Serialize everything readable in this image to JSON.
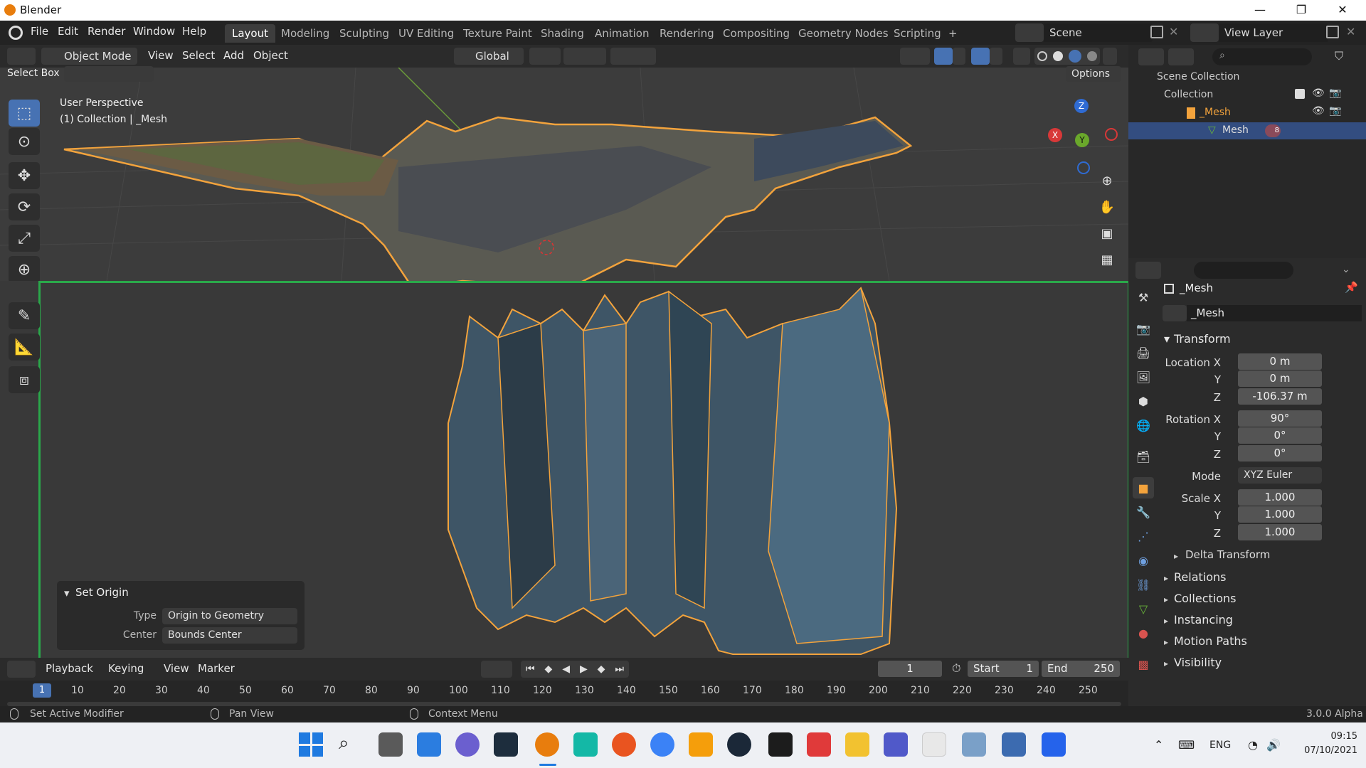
{
  "window": {
    "title": "Blender",
    "controls": [
      "—",
      "❐",
      "✕"
    ]
  },
  "menubar": {
    "items": [
      "File",
      "Edit",
      "Render",
      "Window",
      "Help"
    ]
  },
  "workspaces": {
    "tabs": [
      "Layout",
      "Modeling",
      "Sculpting",
      "UV Editing",
      "Texture Paint",
      "Shading",
      "Animation",
      "Rendering",
      "Compositing",
      "Geometry Nodes",
      "Scripting"
    ],
    "active": "Layout",
    "add_label": "+"
  },
  "scene": {
    "label": "Scene",
    "view_layer": "View Layer"
  },
  "viewport_header": {
    "mode": "Object Mode",
    "menus": [
      "View",
      "Select",
      "Add",
      "Object"
    ],
    "transform_orientation": "Global",
    "select_box_label": "Select Box",
    "options_label": "Options"
  },
  "viewport_overlay": {
    "perspective": "User Perspective",
    "collection_info": "(1) Collection | _Mesh"
  },
  "navigation_gizmo": {
    "z": "Z",
    "y": "Y",
    "x": "X"
  },
  "set_origin_panel": {
    "title": "Set Origin",
    "type_label": "Type",
    "type_value": "Origin to Geometry",
    "center_label": "Center",
    "center_value": "Bounds Center"
  },
  "outliner": {
    "items": [
      {
        "label": "Scene Collection"
      },
      {
        "label": "Collection"
      },
      {
        "label": "_Mesh"
      },
      {
        "label": "Mesh"
      }
    ],
    "badge": "8"
  },
  "properties": {
    "object_name": "_Mesh",
    "datablock_name": "_Mesh",
    "transform_title": "Transform",
    "location": {
      "label": "Location X",
      "x": "0 m",
      "y": "0 m",
      "z": "-106.37 m"
    },
    "rotation": {
      "label": "Rotation X",
      "x": "90°",
      "y": "0°",
      "z": "0°"
    },
    "mode_label": "Mode",
    "mode_value": "XYZ Euler",
    "scale": {
      "label": "Scale X",
      "x": "1.000",
      "y": "1.000",
      "z": "1.000"
    },
    "axis_y": "Y",
    "axis_z": "Z",
    "sections": [
      "Delta Transform",
      "Relations",
      "Collections",
      "Instancing",
      "Motion Paths",
      "Visibility"
    ]
  },
  "timeline": {
    "menus": [
      "Playback",
      "Keying",
      "View",
      "Marker"
    ],
    "current_frame": "1",
    "start_label": "Start",
    "start": "1",
    "end_label": "End",
    "end": "250",
    "ticks": [
      "10",
      "20",
      "30",
      "40",
      "50",
      "60",
      "70",
      "80",
      "90",
      "100",
      "110",
      "120",
      "130",
      "140",
      "150",
      "160",
      "170",
      "180",
      "190",
      "200",
      "210",
      "220",
      "230",
      "240",
      "250"
    ],
    "frame_marker": "1"
  },
  "statusbar": {
    "hint1": "Set Active Modifier",
    "hint2": "Pan View",
    "hint3": "Context Menu",
    "version": "3.0.0 Alpha"
  },
  "taskbar": {
    "lang": "ENG",
    "time": "09:15",
    "date": "07/10/2021"
  },
  "colors": {
    "accent_blue": "#4772b3",
    "selection_orange": "#f3a33c",
    "highlight_green": "#2aa84a"
  }
}
